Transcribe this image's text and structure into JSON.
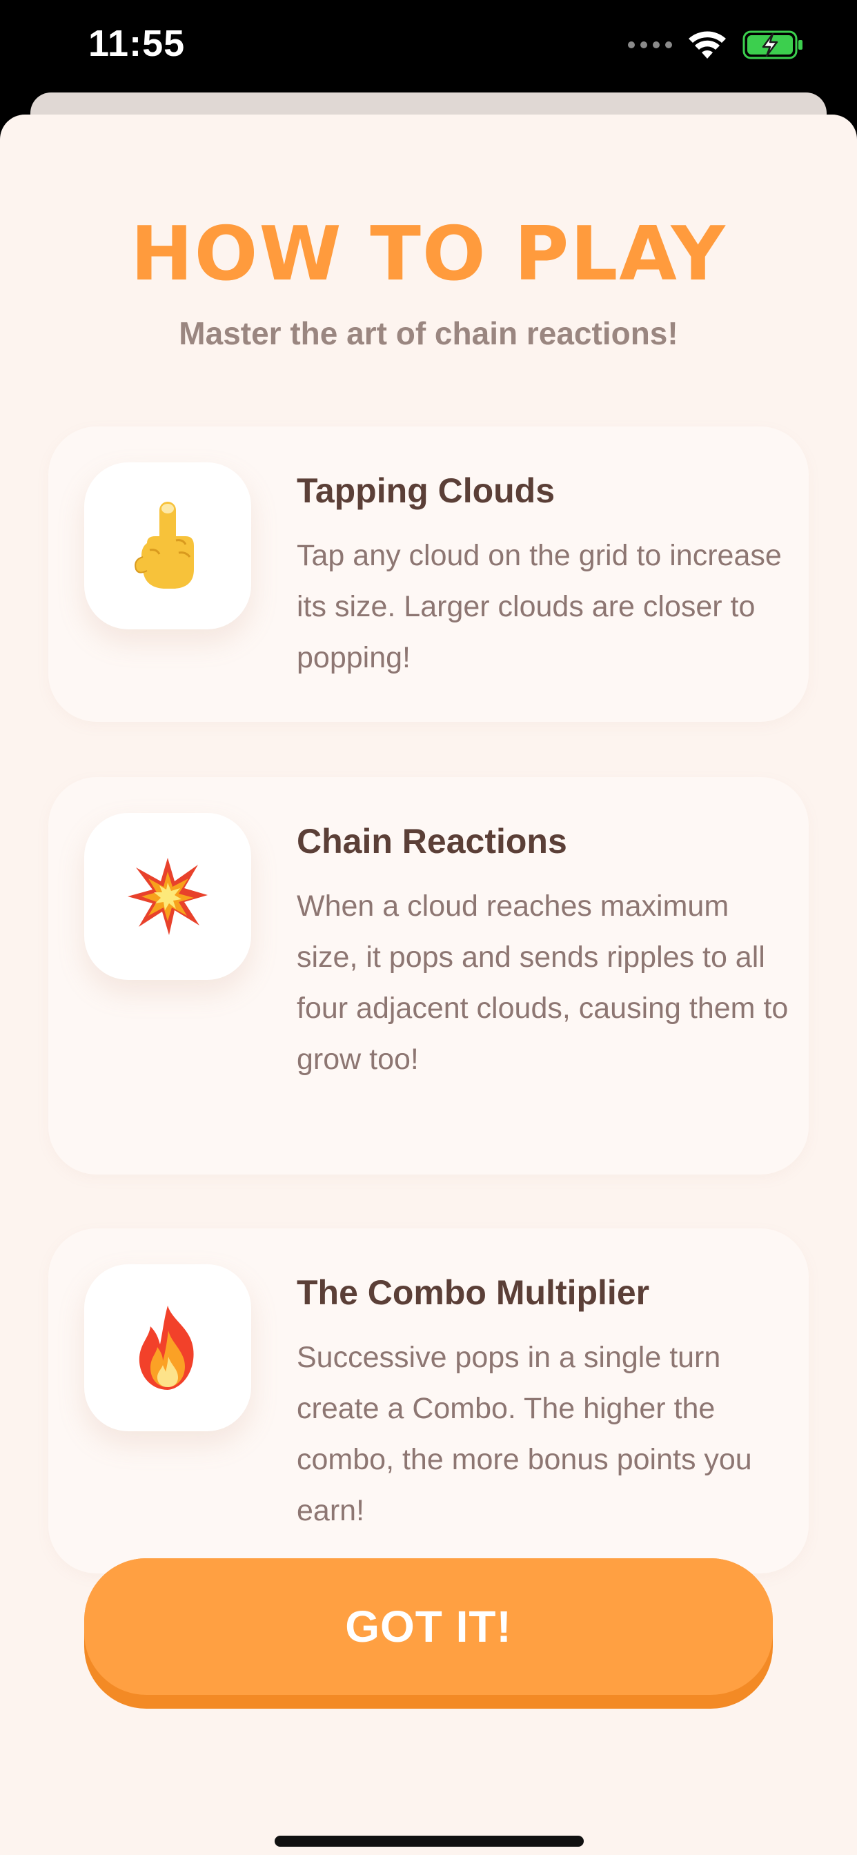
{
  "status_bar": {
    "time": "11:55",
    "icons": [
      "signal-dots-icon",
      "wifi-icon",
      "battery-charging-icon"
    ],
    "battery_color": "#3ccf4e"
  },
  "header": {
    "title": "HOW TO PLAY",
    "subtitle": "Master the art of chain reactions!"
  },
  "cards": [
    {
      "icon": "pointing-finger-icon",
      "emoji": "👆",
      "title": "Tapping Clouds",
      "body": "Tap any cloud on the grid to increase its size. Larger clouds are closer to popping!"
    },
    {
      "icon": "explosion-icon",
      "emoji": "💥",
      "title": "Chain Reactions",
      "body": "When a cloud reaches maximum size, it pops and sends ripples to all four adjacent clouds, causing them to grow too!"
    },
    {
      "icon": "fire-icon",
      "emoji": "🔥",
      "title": "The Combo Multiplier",
      "body": "Successive pops in a single turn create a Combo. The higher the combo, the more bonus points you earn!"
    }
  ],
  "primary_button": {
    "label": "GOT IT!"
  },
  "colors": {
    "accent": "#ff9b3d",
    "button": "#ffa042",
    "button_shadow": "#f38a25",
    "sheet_background": "#fdf4ef",
    "card_title": "#5b3f37",
    "card_body": "#8d7672"
  }
}
